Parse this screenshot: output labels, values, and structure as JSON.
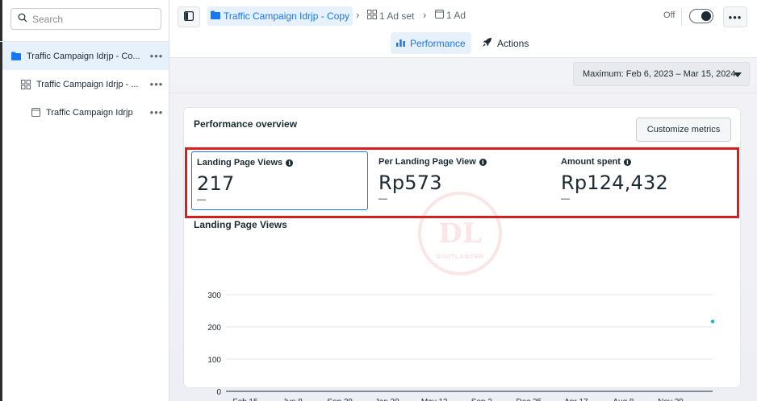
{
  "sidebar": {
    "search_placeholder": "Search",
    "items": [
      {
        "label": "Traffic Campaign Idrjp - Co...",
        "icon": "folder-icon",
        "more": "•••"
      },
      {
        "label": "Traffic Campaign Idrjp - ...",
        "icon": "adset-grid-icon",
        "more": "•••"
      },
      {
        "label": "Traffic Campaign Idrjp",
        "icon": "ad-icon",
        "more": "•••"
      }
    ]
  },
  "header": {
    "breadcrumb_campaign": "Traffic Campaign Idrjp - Copy",
    "breadcrumb_adset": "1 Ad set",
    "breadcrumb_ad": "1 Ad",
    "toggle_label": "Off",
    "more": "•••",
    "tabs": [
      {
        "label": "Performance",
        "icon": "chart-bars-icon",
        "active": true
      },
      {
        "label": "Actions",
        "icon": "rocket-icon",
        "active": false
      }
    ]
  },
  "main": {
    "date_range": "Maximum: Feb 6, 2023 – Mar 15, 2024",
    "card": {
      "title": "Performance overview",
      "customize_button": "Customize metrics",
      "metrics": [
        {
          "label": "Landing Page Views",
          "value": "217",
          "change": "—"
        },
        {
          "label": "Per Landing Page View",
          "value": "Rp573",
          "change": "—"
        },
        {
          "label": "Amount spent",
          "value": "Rp124,432",
          "change": "—"
        }
      ],
      "info_glyph": "i",
      "chart_title": "Landing Page Views"
    },
    "watermark_text": "DL",
    "watermark_sub": "DIGITLANCER"
  },
  "colors": {
    "accent": "#1877f2",
    "highlight_box": "#d61f1f",
    "series": "#2bb5c4"
  },
  "chart_data": {
    "type": "line",
    "title": "Landing Page Views",
    "xlabel": "",
    "ylabel": "",
    "ylim": [
      0,
      300
    ],
    "yticks": [
      0,
      100,
      200,
      300
    ],
    "xticks": [
      "Feb 15",
      "Jun 8",
      "Sep 29",
      "Jan 20",
      "May 13",
      "Sep 3",
      "Dec 25",
      "Apr 17",
      "Aug 8",
      "Nov 29"
    ],
    "grid": true,
    "series": [
      {
        "values": [
          {
            "x": "end",
            "y": 217
          }
        ]
      }
    ]
  }
}
